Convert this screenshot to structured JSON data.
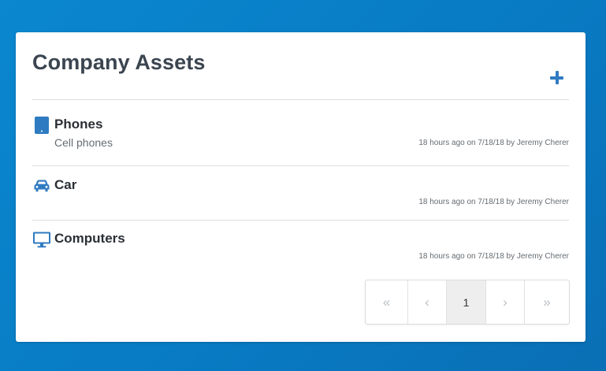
{
  "panel": {
    "title": "Company Assets",
    "add_icon": "plus-icon"
  },
  "assets": [
    {
      "icon": "tablet-icon",
      "name": "Phones",
      "description": "Cell phones",
      "meta": "18 hours ago on 7/18/18 by Jeremy Cherer"
    },
    {
      "icon": "car-icon",
      "name": "Car",
      "description": "",
      "meta": "18 hours ago on 7/18/18 by Jeremy Cherer"
    },
    {
      "icon": "desktop-icon",
      "name": "Computers",
      "description": "",
      "meta": "18 hours ago on 7/18/18 by Jeremy Cherer"
    }
  ],
  "pagination": {
    "first": "«",
    "prev": "‹",
    "current_page": "1",
    "next": "›",
    "last": "»"
  },
  "colors": {
    "accent": "#2f7bc1",
    "background": "#0882cb",
    "card": "#ffffff"
  }
}
